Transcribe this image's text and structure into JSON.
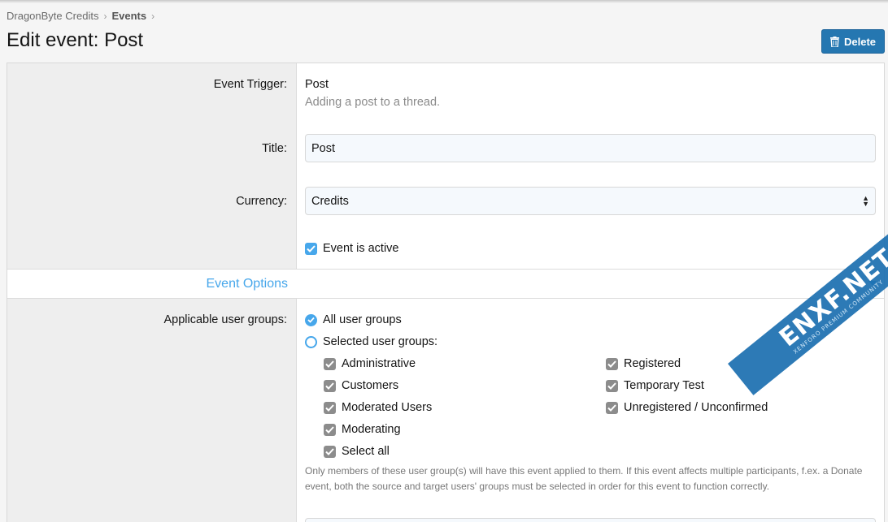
{
  "breadcrumb": {
    "items": [
      "DragonByte Credits",
      "Events"
    ],
    "separator": "›"
  },
  "page": {
    "title": "Edit event: Post"
  },
  "header": {
    "delete_label": "Delete"
  },
  "form": {
    "event_trigger": {
      "label": "Event Trigger:",
      "value": "Post",
      "hint": "Adding a post to a thread."
    },
    "title": {
      "label": "Title:",
      "value": "Post"
    },
    "currency": {
      "label": "Currency:",
      "selected": "Credits"
    },
    "active": {
      "label": "Event is active",
      "checked": true
    }
  },
  "section": {
    "title": "Event Options"
  },
  "user_groups": {
    "label": "Applicable user groups:",
    "all_label": "All user groups",
    "selected_label": "Selected user groups:",
    "mode": "all",
    "left_column": [
      "Administrative",
      "Customers",
      "Moderated Users",
      "Moderating",
      "Select all"
    ],
    "right_column": [
      "Registered",
      "Temporary Test",
      "Unregistered / Unconfirmed"
    ],
    "explain": "Only members of these user group(s) will have this event applied to them. If this event affects multiple participants, f.ex. a Donate event, both the source and target users' groups must be selected in order for this event to function correctly."
  },
  "watermark": {
    "text": "ENXF.NET",
    "subtext": "XENFORO PREMIUM COMMUNITY"
  },
  "colors": {
    "accent": "#47a7eb",
    "button": "#2577b1",
    "label_bg": "#eeeeee"
  }
}
